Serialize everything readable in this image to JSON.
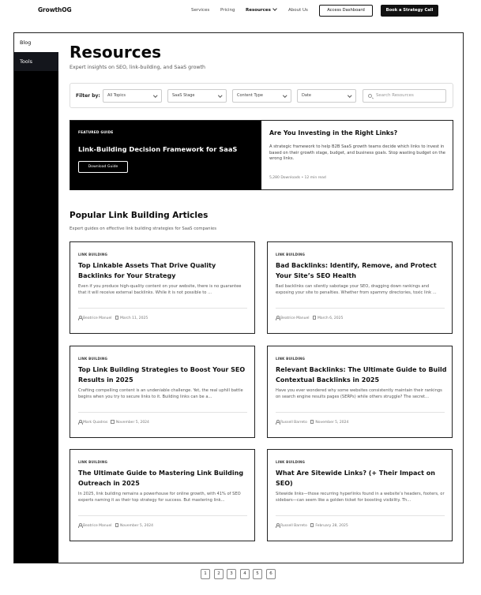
{
  "nav": {
    "logo": "GrowthOG",
    "links": [
      "Services",
      "Pricing",
      "Resources",
      "About Us"
    ],
    "access_dashboard": "Access Dashboard",
    "book_call": "Book a Strategy Call"
  },
  "sidebar": {
    "items": [
      {
        "label": "Blog"
      },
      {
        "label": "Tools"
      }
    ]
  },
  "header": {
    "title": "Resources",
    "subtitle": "Expert insights on SEO, link-building, and SaaS growth"
  },
  "filters": {
    "label": "Filter by:",
    "topics": "All Topics",
    "stage": "SaaS Stage",
    "content_type": "Content Type",
    "date": "Date",
    "search_placeholder": "Search Resources"
  },
  "featured": {
    "tag": "FEATURED GUIDE",
    "title": "Link-Building Decision Framework for SaaS",
    "button": "Download Guide",
    "heading": "Are You Investing in the Right Links?",
    "description": "A strategic framework to help B2B SaaS growth teams decide which links to invest in based on their growth stage, budget, and business goals. Stop wasting budget on the wrong links.",
    "meta": "5,280 Downloads • 12 min read"
  },
  "section": {
    "title": "Popular Link Building Articles",
    "subtitle": "Expert guides on effective link building strategies for SaaS companies"
  },
  "articles": [
    {
      "tag": "LINK BUILDING",
      "title": "Top Linkable Assets That Drive Quality Backlinks for Your Strategy",
      "excerpt": "Even if you produce high-quality content on your website, there is no guarantee that it will receive external backlinks.  While it is not possible to ...",
      "author": "Beatrice Manuel",
      "date": "March 11, 2025"
    },
    {
      "tag": "LINK BUILDING",
      "title": "Bad Backlinks: Identify, Remove, and Protect Your Site’s SEO Health",
      "excerpt": "Bad backlinks can silently sabotage your SEO, dragging down rankings and exposing your site to penalties. Whether from spammy directories, toxic link ...",
      "author": "Beatrice Manuel",
      "date": "March 6, 2025"
    },
    {
      "tag": "LINK BUILDING",
      "title": "Top Link Building Strategies to Boost Your SEO Results in 2025",
      "excerpt": "Crafting compelling content is an undeniable challenge. Yet, the real uphill battle begins when you try to secure links to it. Building links can be a...",
      "author": "Mark Quadros",
      "date": "November 5, 2024"
    },
    {
      "tag": "LINK BUILDING",
      "title": "Relevant Backlinks: The Ultimate Guide to Build Contextual Backlinks in 2025",
      "excerpt": "Have you ever wondered why some websites consistently maintain their rankings on search engine results pages (SERPs) while others struggle? The secret...",
      "author": "Russell Barreto",
      "date": "November 5, 2024"
    },
    {
      "tag": "LINK BUILDING",
      "title": "The Ultimate Guide to Mastering Link Building Outreach in 2025",
      "excerpt": "In 2025, link building remains a powerhouse for online growth, with 41% of SEO experts naming it as their top strategy for success. But mastering link...",
      "author": "Beatrice Manuel",
      "date": "November 5, 2024"
    },
    {
      "tag": "LINK BUILDING",
      "title": "What Are Sitewide Links? (+ Their Impact on SEO)",
      "excerpt": "Sitewide links—those recurring hyperlinks found in a website’s headers, footers, or sidebars—can seem like a golden ticket for boosting visibility. Th...",
      "author": "Russell Barreto",
      "date": "February 28, 2025"
    }
  ],
  "pagination": [
    "1",
    "2",
    "3",
    "4",
    "5",
    "6"
  ]
}
